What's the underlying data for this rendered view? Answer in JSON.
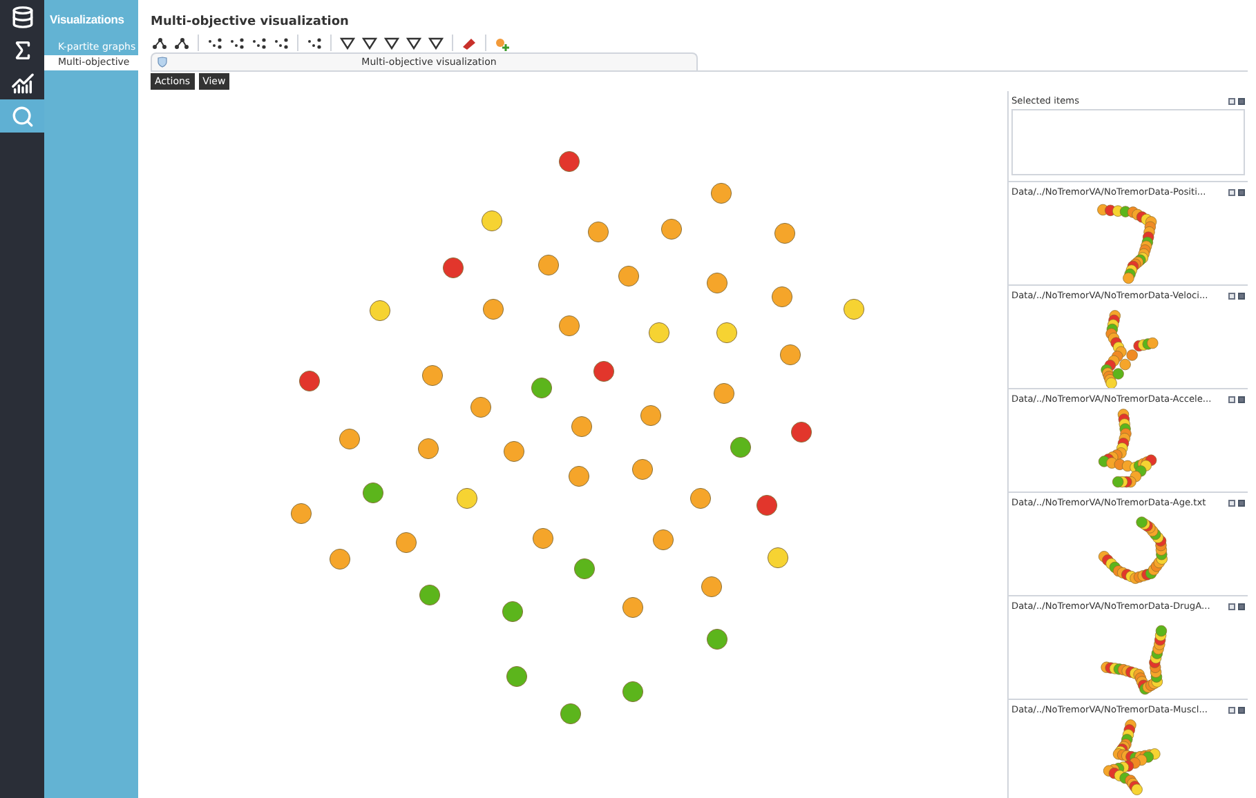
{
  "rail": [
    {
      "selected": false
    },
    {
      "selected": false
    },
    {
      "selected": false
    },
    {
      "selected": true
    }
  ],
  "sidebar": {
    "title": "Visualizations",
    "items": [
      {
        "label": "K-partite graphs",
        "selected": false
      },
      {
        "label": "Multi-objective",
        "selected": true
      }
    ]
  },
  "header": {
    "title": "Multi-objective visualization"
  },
  "tab": {
    "label": "Multi-objective visualization"
  },
  "menu_buttons": [
    "Actions",
    "View"
  ],
  "plot": {
    "nodes": [
      {
        "color": "#e2362c"
      },
      {
        "color": "#f5a52a"
      },
      {
        "color": "#f6d332"
      },
      {
        "color": "#f5a52a"
      },
      {
        "color": "#f5a52a"
      },
      {
        "color": "#f5a52a"
      },
      {
        "color": "#e2362c"
      },
      {
        "color": "#f5a52a"
      },
      {
        "color": "#f5a52a"
      },
      {
        "color": "#f5a52a"
      },
      {
        "color": "#f6d332"
      },
      {
        "color": "#f5a52a"
      },
      {
        "color": "#f5a52a"
      },
      {
        "color": "#f6d332"
      },
      {
        "color": "#f5a52a"
      },
      {
        "color": "#f6d332"
      },
      {
        "color": "#f6d332"
      },
      {
        "color": "#f5a52a"
      },
      {
        "color": "#e2362c"
      },
      {
        "color": "#f5a52a"
      },
      {
        "color": "#e2362c"
      },
      {
        "color": "#5cb51c"
      },
      {
        "color": "#f5a52a"
      },
      {
        "color": "#f5a52a"
      },
      {
        "color": "#f5a52a"
      },
      {
        "color": "#f5a52a"
      },
      {
        "color": "#f5a52a"
      },
      {
        "color": "#f5a52a"
      },
      {
        "color": "#f5a52a"
      },
      {
        "color": "#5cb51c"
      },
      {
        "color": "#e2362c"
      },
      {
        "color": "#f5a52a"
      },
      {
        "color": "#f5a52a"
      },
      {
        "color": "#5cb51c"
      },
      {
        "color": "#f6d332"
      },
      {
        "color": "#f5a52a"
      },
      {
        "color": "#e2362c"
      },
      {
        "color": "#f5a52a"
      },
      {
        "color": "#f5a52a"
      },
      {
        "color": "#f5a52a"
      },
      {
        "color": "#f5a52a"
      },
      {
        "color": "#f5a52a"
      },
      {
        "color": "#f6d332"
      },
      {
        "color": "#5cb51c"
      },
      {
        "color": "#5cb51c"
      },
      {
        "color": "#f5a52a"
      },
      {
        "color": "#5cb51c"
      },
      {
        "color": "#f5a52a"
      },
      {
        "color": "#5cb51c"
      },
      {
        "color": "#5cb51c"
      },
      {
        "color": "#5cb51c"
      },
      {
        "color": "#5cb51c"
      }
    ]
  },
  "side_panel": {
    "panels": [
      {
        "title": "Selected items",
        "kind": "list"
      },
      {
        "title": "Data/../NoTremorVA/NoTremorData-Positi...",
        "kind": "thumbnail"
      },
      {
        "title": "Data/../NoTremorVA/NoTremorData-Veloci...",
        "kind": "thumbnail"
      },
      {
        "title": "Data/../NoTremorVA/NoTremorData-Accele...",
        "kind": "thumbnail"
      },
      {
        "title": "Data/../NoTremorVA/NoTremorData-Age.txt",
        "kind": "thumbnail"
      },
      {
        "title": "Data/../NoTremorVA/NoTremorData-DrugA...",
        "kind": "thumbnail"
      },
      {
        "title": "Data/../NoTremorVA/NoTremorData-Muscl...",
        "kind": "thumbnail"
      }
    ]
  }
}
